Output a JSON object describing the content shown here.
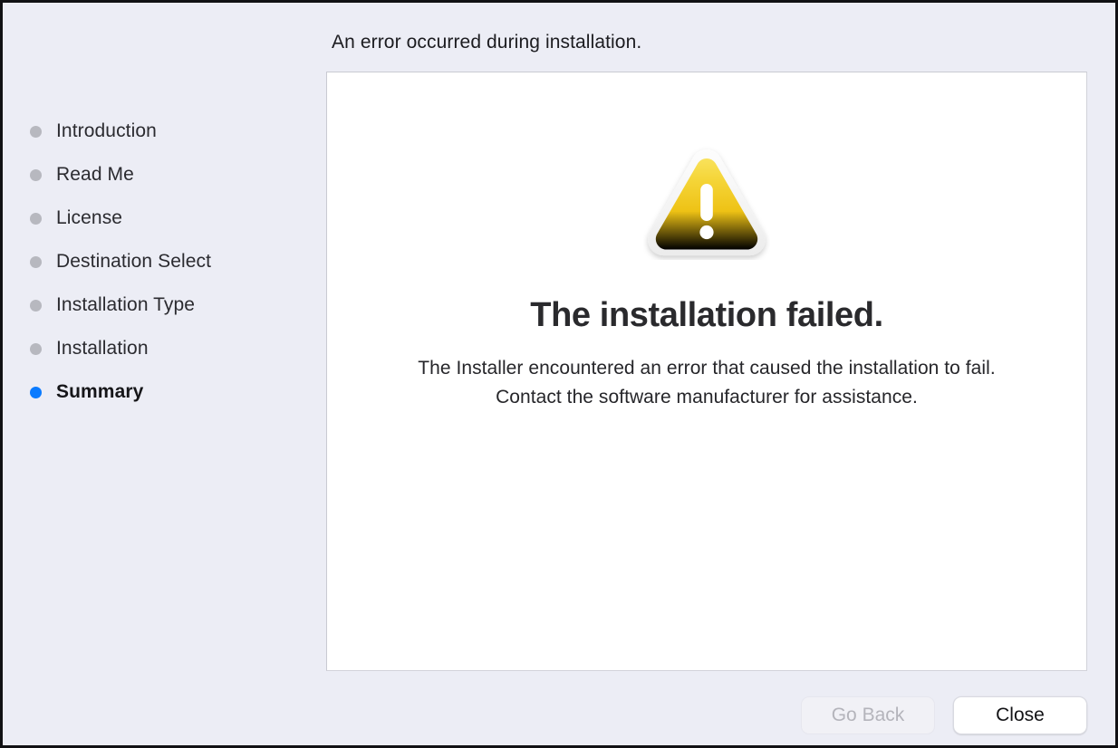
{
  "window": {
    "background_color": "#ecedf5",
    "border_color": "#111114"
  },
  "sidebar": {
    "active_bullet_color": "#0a7bff",
    "inactive_bullet_color": "#b7b8bf",
    "items": [
      {
        "label": "Introduction",
        "state": "done"
      },
      {
        "label": "Read Me",
        "state": "done"
      },
      {
        "label": "License",
        "state": "done"
      },
      {
        "label": "Destination Select",
        "state": "done"
      },
      {
        "label": "Installation Type",
        "state": "done"
      },
      {
        "label": "Installation",
        "state": "done"
      },
      {
        "label": "Summary",
        "state": "active"
      }
    ]
  },
  "content": {
    "title": "An error occurred during installation.",
    "icon": "warning-triangle-icon",
    "icon_colors": {
      "fill_top": "#f7dc3d",
      "fill_bottom": "#e0a800",
      "rim": "#f2f2f0",
      "mark": "#ffffff"
    },
    "heading": "The installation failed.",
    "body": "The Installer encountered an error that caused the installation to fail. Contact the software manufacturer for assistance."
  },
  "footer": {
    "go_back_label": "Go Back",
    "go_back_enabled": false,
    "close_label": "Close",
    "close_enabled": true
  }
}
